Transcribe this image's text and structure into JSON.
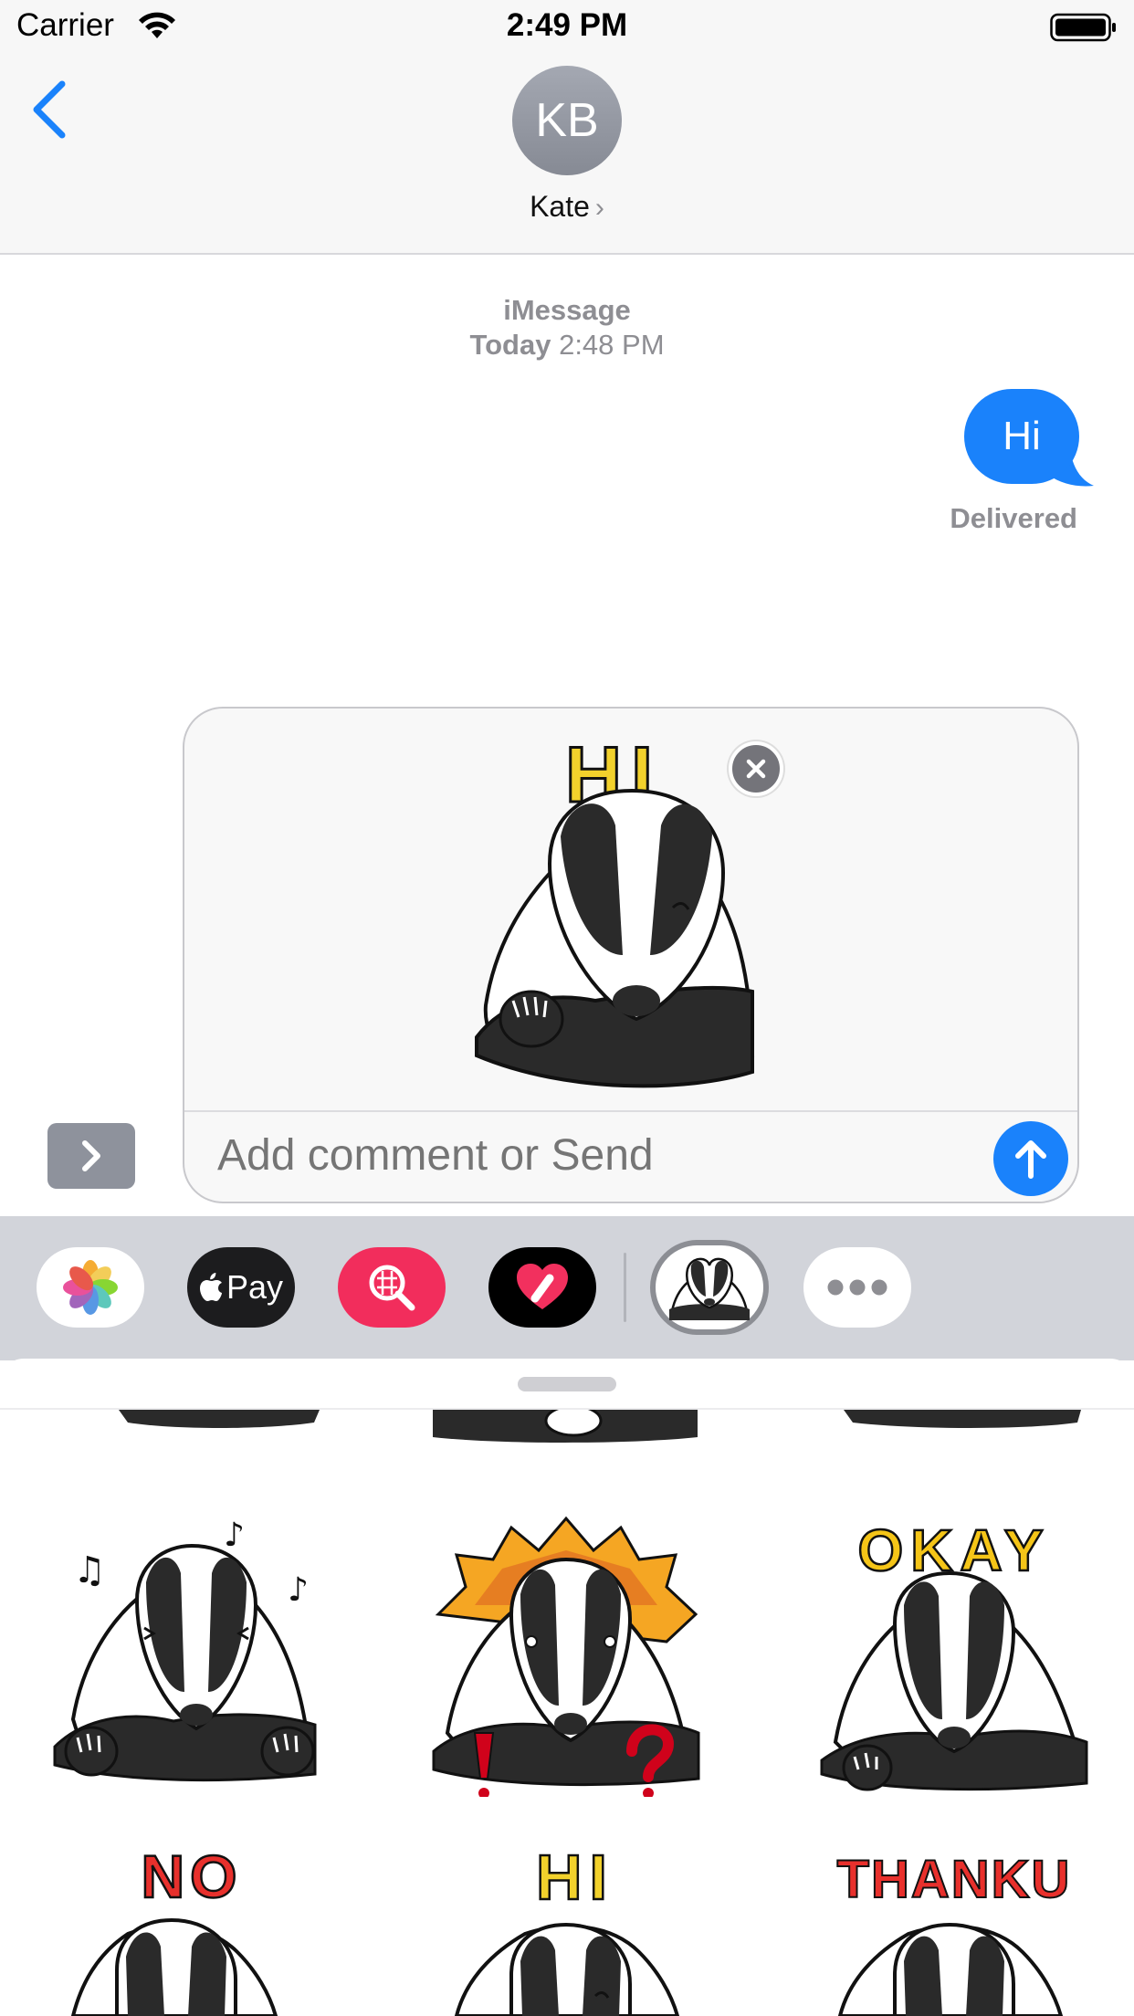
{
  "status_bar": {
    "carrier": "Carrier",
    "time": "2:49 PM"
  },
  "header": {
    "avatar_initials": "KB",
    "contact_name": "Kate",
    "contact_chevron": "›"
  },
  "conversation": {
    "service": "iMessage",
    "date_label": "Today",
    "time_label": "2:48 PM",
    "messages": [
      {
        "text": "Hi",
        "from": "me",
        "color": "#1a82fb"
      }
    ],
    "delivery_status": "Delivered"
  },
  "compose": {
    "placeholder": "Add comment or Send",
    "staged_sticker": "HI"
  },
  "app_drawer": {
    "apps": [
      {
        "name": "photos-app-icon"
      },
      {
        "name": "apple-pay-app",
        "label": "Pay",
        "logo": ""
      },
      {
        "name": "image-search-app-icon"
      },
      {
        "name": "digital-touch-app-icon"
      },
      {
        "name": "badger-sticker-app-icon"
      },
      {
        "name": "more-apps-icon"
      }
    ]
  },
  "sticker_panel": {
    "stickers": [
      {
        "label": ""
      },
      {
        "label": ""
      },
      {
        "label": "OKAY"
      },
      {
        "label": "NO"
      },
      {
        "label": "HI"
      },
      {
        "label": "THANKU"
      }
    ]
  },
  "colors": {
    "accent": "#1a82fb",
    "search_app": "#f22d5c",
    "badger_black": "#2a2a2a"
  }
}
